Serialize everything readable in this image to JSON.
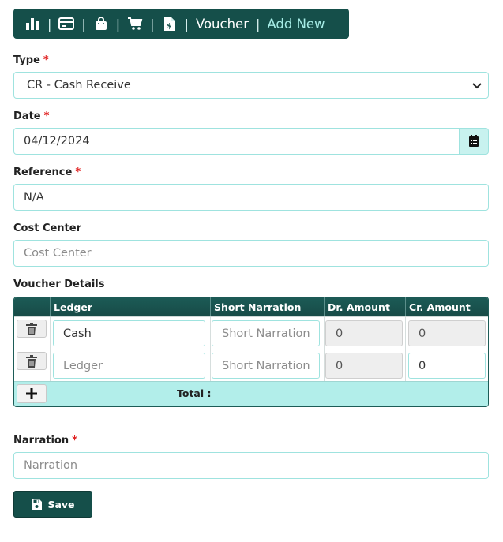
{
  "nav": {
    "icons": [
      "bar-chart-icon",
      "credit-card-icon",
      "shopping-bag-icon",
      "shopping-cart-icon",
      "invoice-icon"
    ],
    "crumb": "Voucher",
    "crumb_link": "Add New",
    "separator": "|"
  },
  "form": {
    "type": {
      "label": "Type",
      "required_mark": "*",
      "value": "CR - Cash Receive"
    },
    "date": {
      "label": "Date",
      "required_mark": "*",
      "value": "04/12/2024"
    },
    "reference": {
      "label": "Reference",
      "required_mark": "*",
      "value": "N/A"
    },
    "cost_center": {
      "label": "Cost Center",
      "placeholder": "Cost Center"
    },
    "voucher_details": {
      "label": "Voucher Details"
    },
    "narration": {
      "label": "Narration",
      "required_mark": "*",
      "placeholder": "Narration"
    }
  },
  "table": {
    "headers": [
      "Ledger",
      "Short Narration",
      "Dr. Amount",
      "Cr. Amount"
    ],
    "rows": [
      {
        "ledger": "Cash",
        "ledger_is_placeholder": false,
        "short_narration": "Short Narration",
        "dr_amount": "0",
        "cr_amount": "0",
        "cr_editable": false
      },
      {
        "ledger": "Ledger",
        "ledger_is_placeholder": true,
        "short_narration": "Short Narration",
        "dr_amount": "0",
        "cr_amount": "0",
        "cr_editable": true
      }
    ],
    "total_label": "Total :"
  },
  "actions": {
    "save_label": "Save"
  },
  "colors": {
    "primary": "#154f4a",
    "accent_border": "#9fe3df",
    "footer_bg": "#b2eeea",
    "required": "#e02020"
  }
}
